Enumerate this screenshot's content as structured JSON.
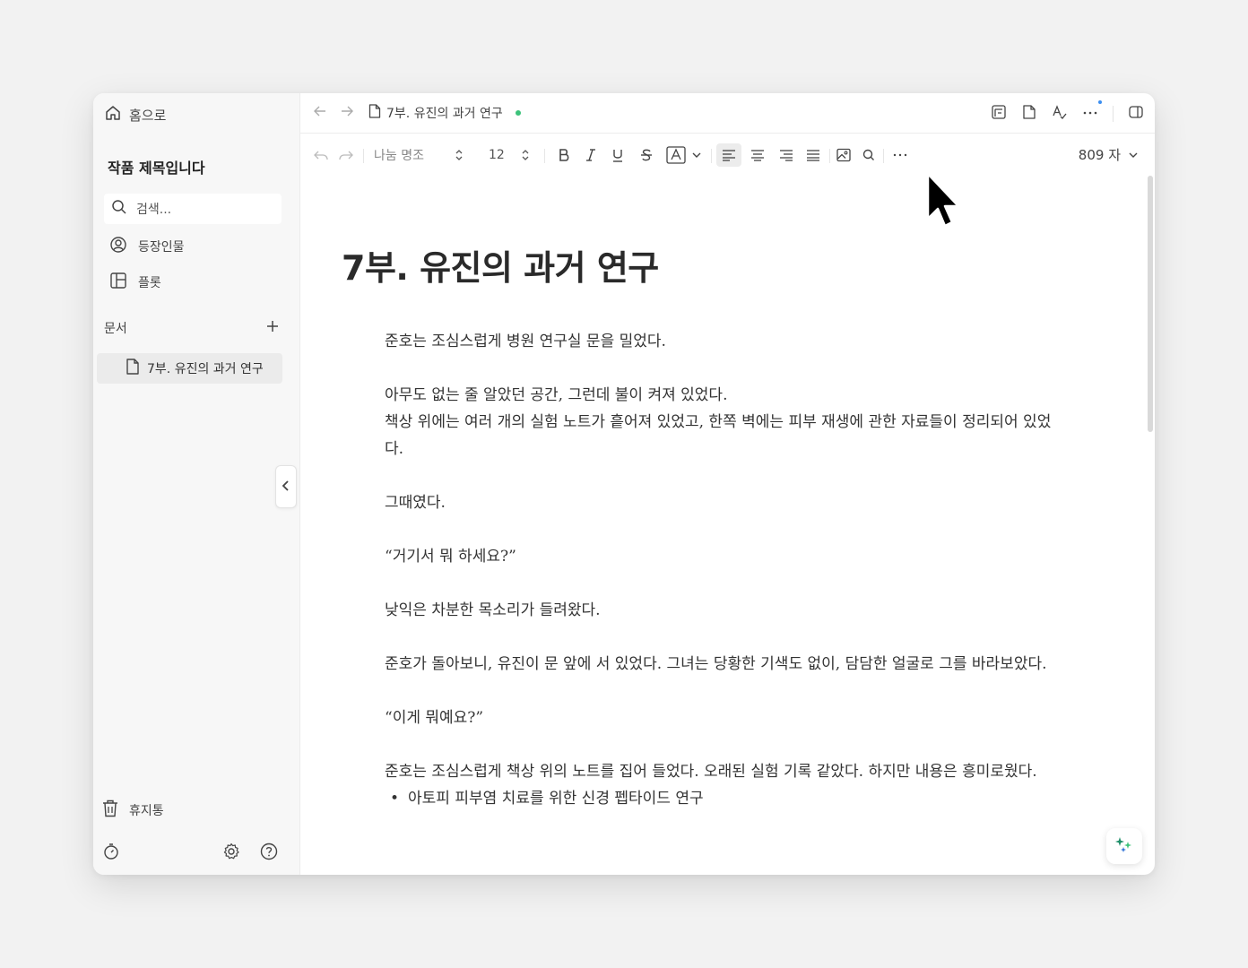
{
  "sidebar": {
    "home_label": "홈으로",
    "project_title": "작품 제목입니다",
    "search_placeholder": "검색...",
    "nav": {
      "characters": "등장인물",
      "plot": "플롯"
    },
    "documents_label": "문서",
    "active_document": "7부. 유진의 과거 연구",
    "trash_label": "휴지통"
  },
  "topbar": {
    "breadcrumb": "7부. 유진의 과거 연구",
    "sync_status_color": "#3cc27a"
  },
  "toolbar": {
    "font_name": "나눔 명조",
    "font_size": "12",
    "word_count": "809 자"
  },
  "document": {
    "title": "7부. 유진의 과거 연구",
    "paragraphs": [
      "준호는 조심스럽게 병원 연구실 문을 밀었다.",
      "",
      "아무도 없는 줄 알았던 공간, 그런데 불이 켜져 있었다.",
      "책상 위에는 여러 개의 실험 노트가 흩어져 있었고, 한쪽 벽에는 피부 재생에 관한 자료들이 정리되어 있었다.",
      "",
      "그때였다.",
      "",
      "“거기서 뭐 하세요?”",
      "",
      "낮익은 차분한 목소리가 들려왔다.",
      "",
      "준호가 돌아보니, 유진이 문 앞에 서 있었다. 그녀는 당황한 기색도 없이, 담담한 얼굴로 그를 바라보았다.",
      "",
      "“이게 뭐예요?”",
      "",
      "준호는 조심스럽게 책상 위의 노트를 집어 들었다. 오래된 실험 기록 같았다. 하지만 내용은 흥미로웠다."
    ],
    "bullets": [
      "아토피 피부염 치료를 위한 신경 펩타이드 연구"
    ]
  }
}
